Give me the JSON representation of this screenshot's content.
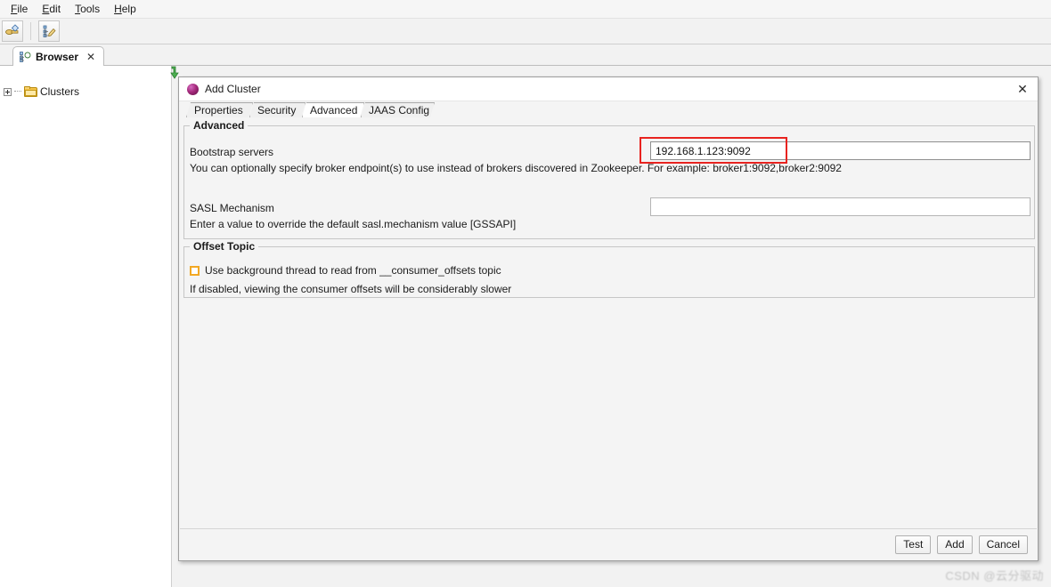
{
  "window": {
    "menu": [
      {
        "label": "File",
        "mnemonic": "F"
      },
      {
        "label": "Edit",
        "mnemonic": "E"
      },
      {
        "label": "Tools",
        "mnemonic": "T"
      },
      {
        "label": "Help",
        "mnemonic": "H"
      }
    ],
    "toolbar": [
      {
        "name": "add-cluster-toolbar-icon"
      },
      {
        "name": "edit-cluster-toolbar-icon"
      }
    ],
    "view_tab": {
      "label": "Browser",
      "close_label": "✕",
      "icon": "browser-tree-icon"
    },
    "tree": {
      "root_label": "Clusters",
      "icon": "folder-icon",
      "expander": "plus-expander-icon"
    },
    "restore_icon": "green-down-arrow-icon"
  },
  "dialog": {
    "title": "Add Cluster",
    "icon": "purple-sphere-icon",
    "close_label": "✕",
    "tabs": [
      {
        "label": "Properties",
        "active": false
      },
      {
        "label": "Security",
        "active": false
      },
      {
        "label": "Advanced",
        "active": true
      },
      {
        "label": "JAAS Config",
        "active": false
      }
    ],
    "advanced_group": {
      "legend": "Advanced",
      "bootstrap": {
        "label": "Bootstrap servers",
        "value": "192.168.1.123:9092",
        "placeholder": "",
        "hint": "You can optionally specify broker endpoint(s) to use instead of brokers discovered in Zookeeper. For example: broker1:9092,broker2:9092",
        "highlighted": true,
        "highlight_color": "#e8231f"
      },
      "sasl": {
        "label": "SASL Mechanism",
        "value": "",
        "placeholder": "",
        "hint": "Enter a value to override the default sasl.mechanism value [GSSAPI]"
      }
    },
    "offset_group": {
      "legend": "Offset Topic",
      "checkbox": {
        "label": "Use background thread to read from __consumer_offsets topic",
        "checked": false,
        "accent_color": "#f2a823"
      },
      "hint": "If disabled, viewing the consumer offsets will be considerably slower"
    },
    "buttons": [
      {
        "label": "Test",
        "name": "test-button"
      },
      {
        "label": "Add",
        "name": "add-button"
      },
      {
        "label": "Cancel",
        "name": "cancel-button"
      }
    ]
  },
  "watermark": {
    "text": "CSDN @云分驱动"
  }
}
